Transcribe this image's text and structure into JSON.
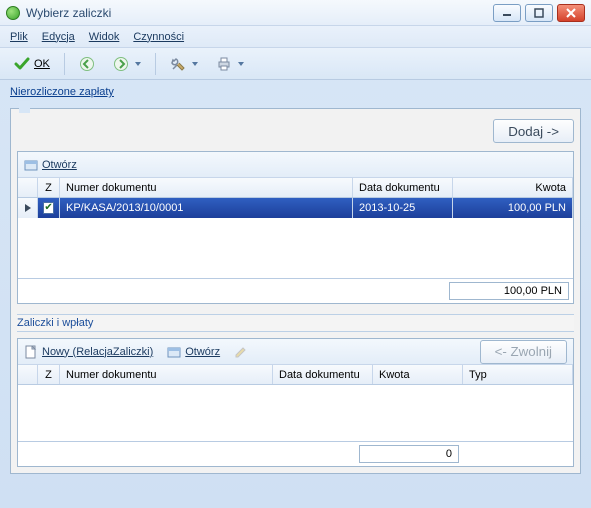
{
  "window": {
    "title": "Wybierz zaliczki"
  },
  "menu": {
    "file": "Plik",
    "edit": "Edycja",
    "view": "Widok",
    "actions": "Czynności"
  },
  "toolbar": {
    "ok": "OK"
  },
  "links": {
    "unsettled": "Nierozliczone zapłaty"
  },
  "buttons": {
    "add": "Dodaj ->",
    "release": "<- Zwolnij"
  },
  "top_section": {
    "open": "Otwórz",
    "columns": {
      "z": "Z",
      "doc": "Numer dokumentu",
      "date": "Data dokumentu",
      "amt": "Kwota"
    },
    "rows": [
      {
        "checked": true,
        "doc": "KP/KASA/2013/10/0001",
        "date": "2013-10-25",
        "amt": "100,00 PLN"
      }
    ],
    "sum": "100,00 PLN"
  },
  "second_label": "Zaliczki i wpłaty",
  "bottom_section": {
    "new": "Nowy (RelacjaZaliczki)",
    "open": "Otwórz",
    "columns": {
      "z": "Z",
      "doc": "Numer dokumentu",
      "date": "Data dokumentu",
      "amt": "Kwota",
      "type": "Typ"
    },
    "sum": "0"
  }
}
